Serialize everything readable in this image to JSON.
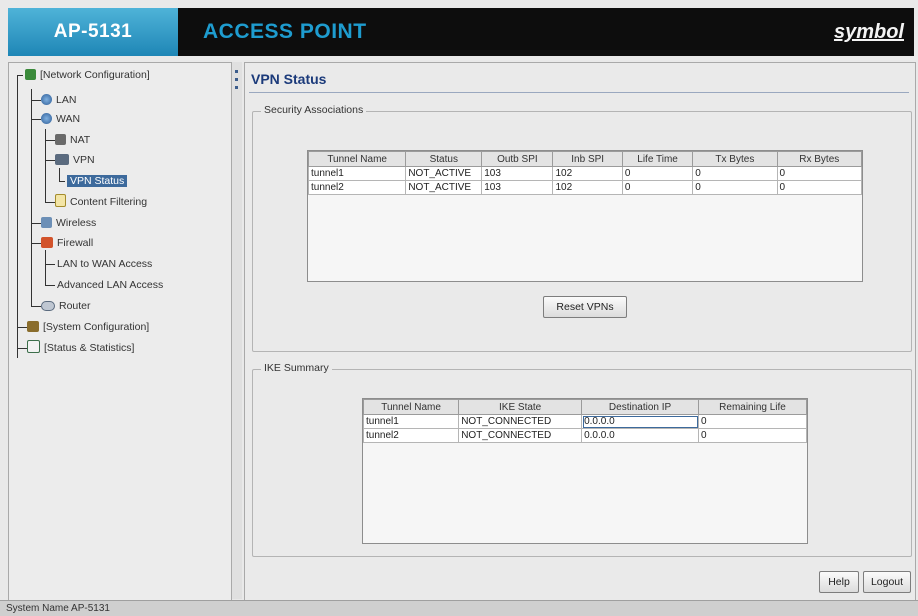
{
  "header": {
    "model": "AP-5131",
    "product": "ACCESS POINT",
    "brand": "symbol"
  },
  "nav": {
    "items": [
      {
        "label": "[Network Configuration]",
        "icon": "network-icon"
      },
      {
        "label": "LAN",
        "icon": "globe-icon"
      },
      {
        "label": "WAN",
        "icon": "globe-icon"
      },
      {
        "label": "NAT",
        "icon": "nat-icon"
      },
      {
        "label": "VPN",
        "icon": "vpn-icon"
      },
      {
        "label": "VPN Status",
        "icon": ""
      },
      {
        "label": "Content Filtering",
        "icon": "filter-icon"
      },
      {
        "label": "Wireless",
        "icon": "wireless-icon"
      },
      {
        "label": "Firewall",
        "icon": "firewall-icon"
      },
      {
        "label": "LAN to WAN Access",
        "icon": ""
      },
      {
        "label": "Advanced LAN Access",
        "icon": ""
      },
      {
        "label": "Router",
        "icon": "router-icon"
      },
      {
        "label": "[System Configuration]",
        "icon": "system-config-icon"
      },
      {
        "label": "[Status & Statistics]",
        "icon": "statistics-icon"
      }
    ],
    "selected": "VPN Status"
  },
  "main": {
    "title": "VPN Status",
    "sa": {
      "label": "Security Associations",
      "columns": [
        "Tunnel Name",
        "Status",
        "Outb SPI",
        "Inb SPI",
        "Life Time",
        "Tx Bytes",
        "Rx Bytes"
      ],
      "rows": [
        [
          "tunnel1",
          "NOT_ACTIVE",
          "103",
          "102",
          "0",
          "0",
          "0"
        ],
        [
          "tunnel2",
          "NOT_ACTIVE",
          "103",
          "102",
          "0",
          "0",
          "0"
        ]
      ],
      "reset_label": "Reset VPNs"
    },
    "ike": {
      "label": "IKE Summary",
      "columns": [
        "Tunnel Name",
        "IKE State",
        "Destination IP",
        "Remaining Life"
      ],
      "rows": [
        [
          "tunnel1",
          "NOT_CONNECTED",
          "0.0.0.0",
          "0"
        ],
        [
          "tunnel2",
          "NOT_CONNECTED",
          "0.0.0.0",
          "0"
        ]
      ]
    },
    "help_label": "Help",
    "logout_label": "Logout"
  },
  "status_bar": {
    "text": "System Name AP-5131"
  },
  "colors": {
    "accent": "#1e9ccf",
    "header_bg": "#0d0d0d",
    "title": "#1b3a7a",
    "selection": "#3d6a9c"
  }
}
